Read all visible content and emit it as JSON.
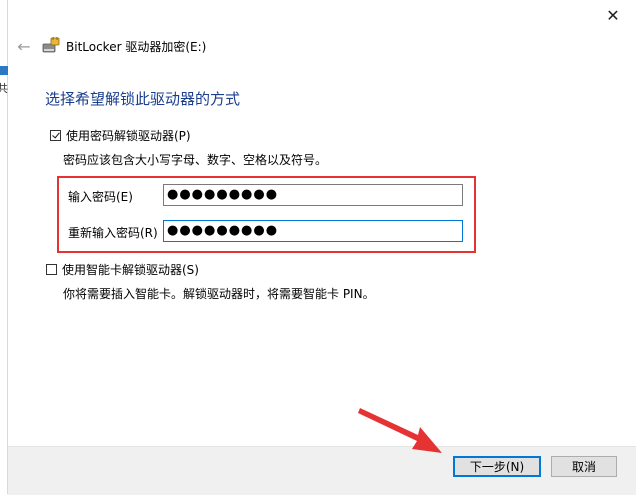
{
  "window": {
    "title": "BitLocker 驱动器加密(E:)",
    "close_glyph": "✕",
    "back_glyph": "←"
  },
  "bg_window": {
    "char": "共"
  },
  "main": {
    "heading": "选择希望解锁此驱动器的方式",
    "password_option": {
      "label": "使用密码解锁驱动器(P)",
      "checked": true,
      "hint": "密码应该包含大小写字母、数字、空格以及符号。",
      "enter_label": "输入密码(E)",
      "enter_value": "●●●●●●●●●",
      "reenter_label": "重新输入密码(R)",
      "reenter_value": "●●●●●●●●●"
    },
    "smartcard_option": {
      "label": "使用智能卡解锁驱动器(S)",
      "checked": false,
      "hint": "你将需要插入智能卡。解锁驱动器时，将需要智能卡 PIN。"
    }
  },
  "footer": {
    "next_label": "下一步(N)",
    "cancel_label": "取消"
  },
  "colors": {
    "heading": "#1a3e8c",
    "highlight": "#e53333",
    "arrow": "#e53333",
    "focus": "#0078d7"
  }
}
